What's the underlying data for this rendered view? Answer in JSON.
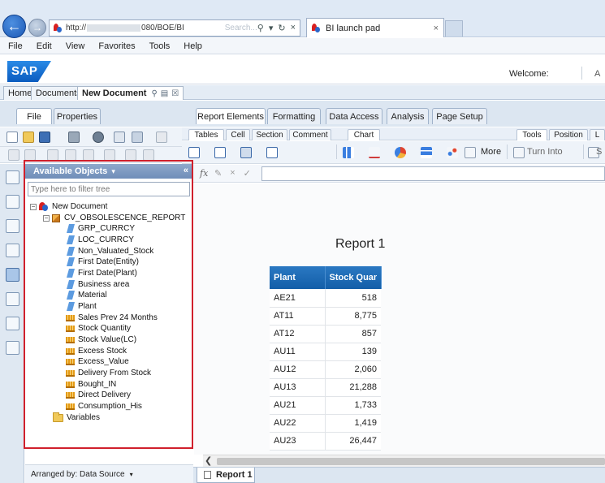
{
  "browser": {
    "url": "http://",
    "url_suffix": "080/BOE/BI",
    "faded_text": "Search...",
    "tab_title": "BI launch pad",
    "tab_close": "×",
    "menus": [
      "File",
      "Edit",
      "View",
      "Favorites",
      "Tools",
      "Help"
    ]
  },
  "header": {
    "logo": "SAP",
    "welcome": "Welcome:",
    "trunc": "A"
  },
  "doc_tabs": {
    "home": "Home",
    "documents": "Documents",
    "new_document": "New Document"
  },
  "left_tabs": {
    "file": "File",
    "properties": "Properties"
  },
  "main_tabs": [
    "Report Elements",
    "Formatting",
    "Data Access",
    "Analysis",
    "Page Setup"
  ],
  "sub_tabs": [
    "Tables",
    "Cell",
    "Section",
    "Comment",
    "Chart",
    "Tools",
    "Position",
    "L"
  ],
  "toolbar": {
    "more": "More",
    "turn_into": "Turn Into",
    "trunc": "S"
  },
  "formula": {
    "fx": "fx"
  },
  "available_objects": {
    "title": "Available Objects",
    "collapse": "«",
    "filter_placeholder": "Type here to filter tree",
    "root": "New Document",
    "universe": "CV_OBSOLESCENCE_REPORT",
    "dimensions": [
      "GRP_CURRCY",
      "LOC_CURRCY",
      "Non_Valuated_Stock",
      "First Date(Entity)",
      "First Date(Plant)",
      "Business area",
      "Material",
      "Plant"
    ],
    "measures": [
      "Sales Prev 24 Months",
      "Stock Quantity",
      "Stock Value(LC)",
      "Excess Stock",
      "Excess_Value",
      "Delivery From Stock",
      "Bought_IN",
      "Direct Delivery",
      "Consumption_His"
    ],
    "variables": "Variables",
    "arranged_by": "Arranged by: Data Source"
  },
  "report": {
    "title": "Report 1",
    "columns": [
      "Plant",
      "Stock Quantity"
    ],
    "rows": [
      [
        "AE21",
        "518"
      ],
      [
        "AT11",
        "8,775"
      ],
      [
        "AT12",
        "857"
      ],
      [
        "AU11",
        "139"
      ],
      [
        "AU12",
        "2,060"
      ],
      [
        "AU13",
        "21,288"
      ],
      [
        "AU21",
        "1,733"
      ],
      [
        "AU22",
        "1,419"
      ],
      [
        "AU23",
        "26,447"
      ]
    ],
    "tab_label": "Report 1"
  }
}
